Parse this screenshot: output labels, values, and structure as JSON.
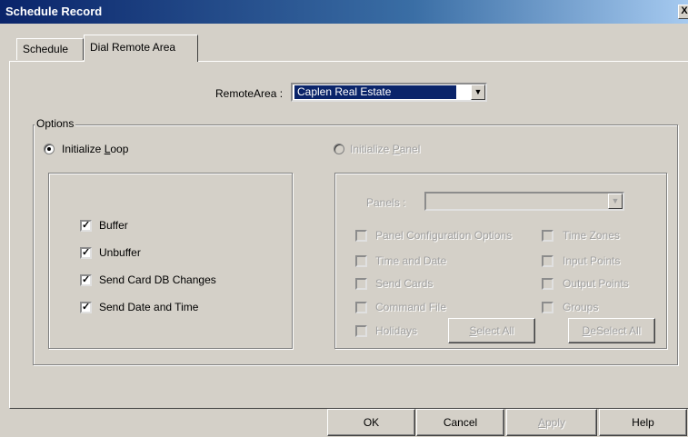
{
  "window": {
    "title": "Schedule Record",
    "close_glyph": "X"
  },
  "tabs": [
    {
      "label": "Schedule"
    },
    {
      "label": "Dial Remote Area"
    }
  ],
  "remote_area": {
    "label": "RemoteArea :",
    "value": "Caplen Real Estate"
  },
  "options": {
    "legend": "Options",
    "init_loop": {
      "prefix": "Initialize ",
      "accel": "L",
      "suffix": "oop",
      "checked": true
    },
    "init_panel": {
      "prefix": "Initialize ",
      "accel": "P",
      "suffix": "anel",
      "checked": false
    }
  },
  "loop_checks": [
    {
      "label": "Buffer",
      "checked": true
    },
    {
      "label": "Unbuffer",
      "checked": true
    },
    {
      "label": "Send Card DB Changes",
      "checked": true
    },
    {
      "label": "Send Date and Time",
      "checked": true
    }
  ],
  "panel_box": {
    "panels_label": "Panels :",
    "panels_value": "",
    "left_checks": [
      {
        "label": "Panel Configuration Options"
      },
      {
        "label": "Time and Date"
      },
      {
        "label": "Send Cards"
      },
      {
        "label": "Command File"
      },
      {
        "label": "Holidays"
      }
    ],
    "right_checks": [
      {
        "label": "Time Zones"
      },
      {
        "label": "Input Points"
      },
      {
        "label": "Output Points"
      },
      {
        "label": "Groups"
      }
    ],
    "select_all": {
      "accel": "S",
      "rest": "elect All"
    },
    "deselect_all": {
      "accel": "D",
      "rest": "eSelect All"
    }
  },
  "footer": {
    "ok": "OK",
    "cancel": "Cancel",
    "apply": {
      "accel": "A",
      "rest": "pply"
    },
    "help": "Help"
  }
}
